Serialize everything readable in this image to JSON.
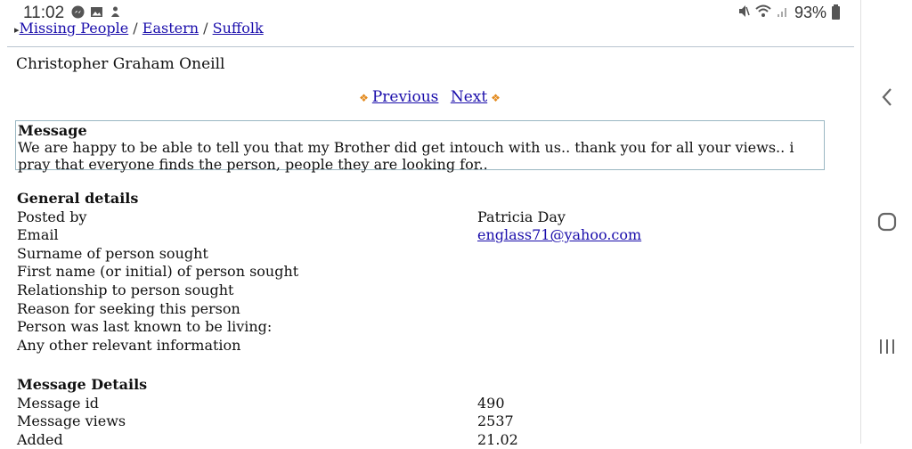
{
  "status_bar": {
    "time": "11:02",
    "battery": "93%",
    "left_icons": [
      "messenger-icon",
      "gallery-icon",
      "notification-icon"
    ],
    "right_icons": [
      "mute-icon",
      "wifi-icon",
      "signal-icon",
      "battery-icon"
    ]
  },
  "breadcrumb": {
    "items": [
      "Missing People",
      "Eastern",
      "Suffolk"
    ],
    "separator": "/"
  },
  "person_name": "Christopher Graham Oneill",
  "pager": {
    "previous": "Previous",
    "next": "Next"
  },
  "message": {
    "heading": "Message",
    "text": "We are happy to be able to tell you that my Brother did get intouch with us.. thank you for all your views.. i pray that everyone finds the person, people they are looking for.."
  },
  "general_details": {
    "heading": "General details",
    "rows": [
      {
        "label": "Posted by",
        "value": "Patricia Day"
      },
      {
        "label": "Email",
        "value": "englass71@yahoo.com"
      },
      {
        "label": "Surname of person sought",
        "value": ""
      },
      {
        "label": "First name (or initial) of person sought",
        "value": ""
      },
      {
        "label": "Relationship to person sought",
        "value": ""
      },
      {
        "label": "Reason for seeking this person",
        "value": ""
      },
      {
        "label": "Person was last known to be living:",
        "value": ""
      },
      {
        "label": "Any other relevant information",
        "value": ""
      }
    ]
  },
  "message_details": {
    "heading": "Message Details",
    "rows": [
      {
        "label": "Message id",
        "value": "490"
      },
      {
        "label": "Message views",
        "value": "2537"
      },
      {
        "label": "Added",
        "value": "21.02"
      }
    ]
  },
  "colors": {
    "link": "#1a0dab",
    "arrow": "#e38a1e",
    "box_border": "#9ab7c2"
  }
}
